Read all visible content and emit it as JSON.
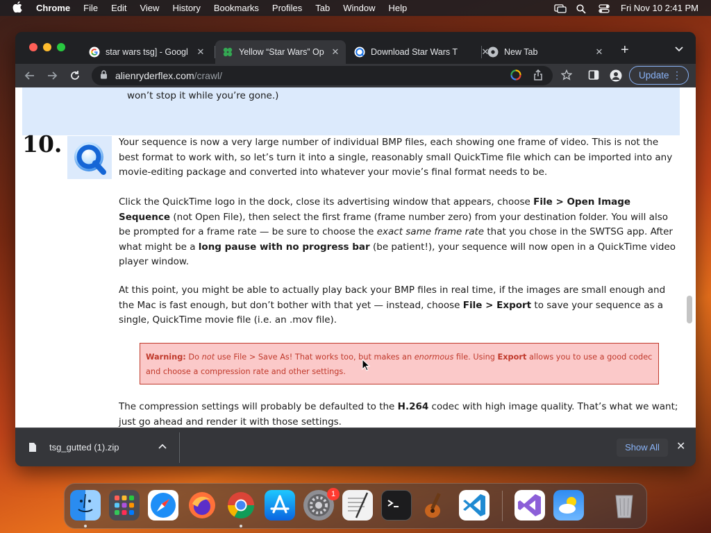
{
  "menubar": {
    "app": "Chrome",
    "items": [
      "File",
      "Edit",
      "View",
      "History",
      "Bookmarks",
      "Profiles",
      "Tab",
      "Window",
      "Help"
    ],
    "clock": "Fri Nov 10  2:41 PM"
  },
  "tabs": [
    {
      "title": "star wars tsg] - Googl",
      "favicon": "google-icon",
      "active": false
    },
    {
      "title": "Yellow “Star Wars” Op",
      "favicon": "clover-icon",
      "active": true
    },
    {
      "title": "Download Star Wars T",
      "favicon": "qt-icon",
      "active": false
    },
    {
      "title": "New Tab",
      "favicon": "chrome-icon",
      "active": false
    }
  ],
  "toolbar": {
    "url_domain": "alienryderflex.com",
    "url_path": "/crawl/",
    "update_label": "Update"
  },
  "page": {
    "top_text": "won’t stop it while you’re gone.)",
    "step_number": "10.",
    "p1": "Your sequence is now a very large number of individual BMP files, each showing one frame of video. This is not the best format to work with, so let’s turn it into a single, reasonably small QuickTime file which can be imported into any movie-editing package and converted into whatever your movie’s final format needs to be.",
    "p2": {
      "a": "Click the QuickTime logo in the dock, close its advertising window that appears, choose ",
      "b": "File > Open Image Sequence",
      "c": " (not Open File), then select the first frame (frame number zero) from your destination folder. You will also be prompted for a frame rate — be sure to choose the ",
      "d": "exact same frame rate",
      "e": " that you chose in the SWTSG app. After what might be a ",
      "f": "long pause with no progress bar",
      "g": " (be patient!), your sequence will now open in a QuickTime video player window."
    },
    "p3": {
      "a": "At this point, you might be able to actually play back your BMP files in real time, if the images are small enough and the Mac is fast enough, but don’t bother with that yet — instead, choose ",
      "b": "File > Export",
      "c": " to save your sequence as a single, QuickTime movie file (i.e. an .mov file)."
    },
    "warning": {
      "label": "Warning:",
      "a": " Do ",
      "b": "not",
      "c": " use File > Save As! That works too, but makes an ",
      "d": "enormous",
      "e": " file. Using ",
      "f": "Export",
      "g": " allows you to use a good codec and choose a compression rate and other settings."
    },
    "p4": {
      "a": "The compression settings will probably be defaulted to the ",
      "b": "H.264",
      "c": " codec with high image quality. That’s what we want; just go ahead and render it with those settings."
    }
  },
  "downloads": {
    "file": "tsg_gutted (1).zip",
    "show_all": "Show All"
  },
  "dock": {
    "apps": [
      "finder-icon",
      "launchpad-icon",
      "safari-icon",
      "firefox-icon",
      "chrome-icon",
      "app-store-icon",
      "system-settings-icon",
      "textedit-icon",
      "terminal-icon",
      "garageband-icon",
      "vscode-icon",
      "visual-studio-icon",
      "weather-icon",
      "trash-icon"
    ],
    "settings_badge": "1"
  }
}
